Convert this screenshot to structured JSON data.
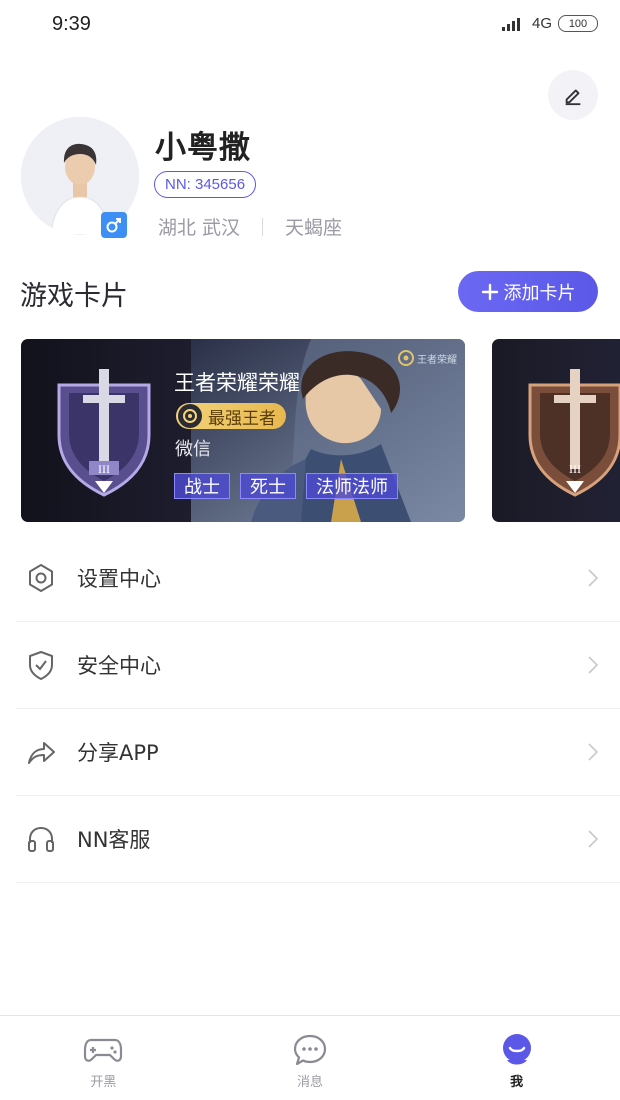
{
  "status_bar": {
    "time": "9:39",
    "network": "4G",
    "battery": "100"
  },
  "profile": {
    "nickname": "小粤撒",
    "user_id": "NN: 345656",
    "location": "湖北 武汉",
    "zodiac": "天蝎座",
    "gender_icon": "male-icon"
  },
  "game_cards_section": {
    "title": "游戏卡片",
    "add_button_label": "添加卡片"
  },
  "game_cards": [
    {
      "title": "王者荣耀荣耀",
      "rank": "最强王者",
      "platform": "微信",
      "tags": [
        "战士",
        "死士",
        "法师法师"
      ],
      "game_logo": "王者荣耀"
    }
  ],
  "menu": {
    "items": [
      {
        "label": "设置中心",
        "icon": "settings-hexagon-icon"
      },
      {
        "label": "安全中心",
        "icon": "shield-check-icon"
      },
      {
        "label": "分享APP",
        "icon": "share-arrow-icon"
      },
      {
        "label": "NN客服",
        "icon": "headphones-icon"
      }
    ]
  },
  "tab_bar": {
    "items": [
      {
        "label": "开黑",
        "icon": "gamepad-icon",
        "active": false
      },
      {
        "label": "消息",
        "icon": "chat-bubble-icon",
        "active": false
      },
      {
        "label": "我",
        "icon": "profile-face-icon",
        "active": true
      }
    ]
  },
  "colors": {
    "accent": "#5b58e8",
    "tag_background": "#4d4ad2",
    "rank_gold": "#e7b84e",
    "gender_blue": "#3d8ff5",
    "muted_text": "#9a9aa5"
  }
}
